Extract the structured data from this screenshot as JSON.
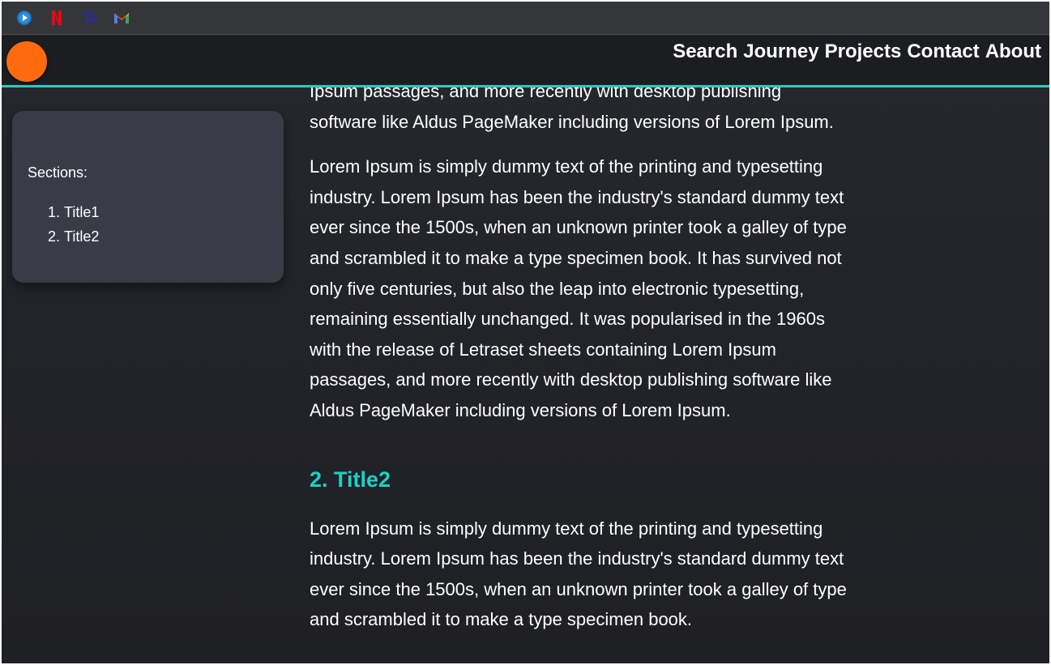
{
  "bookmarks": [
    {
      "name": "media-player-icon"
    },
    {
      "name": "netflix-icon"
    },
    {
      "name": "disney-plus-icon"
    },
    {
      "name": "gmail-icon"
    }
  ],
  "nav": {
    "links": [
      "Search",
      "Journey",
      "Projects",
      "Contact",
      "About"
    ]
  },
  "toc": {
    "heading": "Sections:",
    "items": [
      "Title1",
      "Title2"
    ]
  },
  "content": {
    "partial_paragraph": "Ipsum passages, and more recently with desktop publishing software like Aldus PageMaker including versions of Lorem Ipsum.",
    "paragraph": "Lorem Ipsum is simply dummy text of the printing and typesetting industry. Lorem Ipsum has been the industry's standard dummy text ever since the 1500s, when an unknown printer took a galley of type and scrambled it to make a type specimen book. It has survived not only five centuries, but also the leap into electronic typesetting, remaining essentially unchanged. It was popularised in the 1960s with the release of Letraset sheets containing Lorem Ipsum passages, and more recently with desktop publishing software like Aldus PageMaker including versions of Lorem Ipsum.",
    "section2_title": "2. Title2",
    "section2_paragraph": "Lorem Ipsum is simply dummy text of the printing and typesetting industry. Lorem Ipsum has been the industry's standard dummy text ever since the 1500s, when an unknown printer took a galley of type and scrambled it to make a type specimen book."
  },
  "colors": {
    "accent": "#1fd0c8",
    "logo": "#ff6a0e",
    "card": "#393b46",
    "background": "#232429"
  }
}
